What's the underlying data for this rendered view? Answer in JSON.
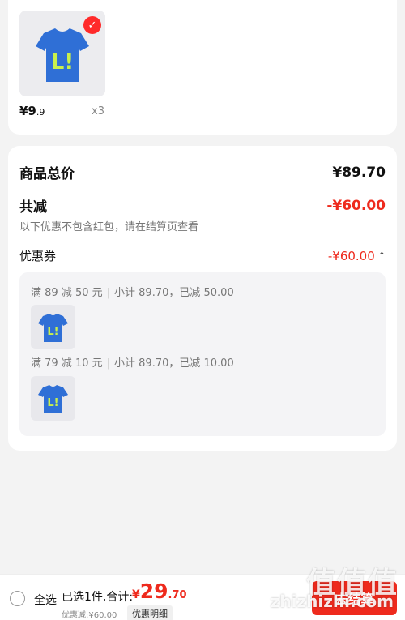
{
  "product": {
    "price_int": "¥9",
    "price_dec": ".9",
    "quantity": "x3",
    "image_icon": "blue-tshirt-icon",
    "shirt_print": "L!"
  },
  "summary": {
    "total_label": "商品总价",
    "total_value": "¥89.70",
    "reduce_label": "共减",
    "reduce_value": "-¥60.00",
    "reduce_note": "以下优惠不包含红包，请在结算页查看",
    "coupon_label": "优惠券",
    "coupon_value": "-¥60.00",
    "coupons": [
      {
        "rule": "满 89 减 50 元",
        "subtotal": "小计 89.70，已减 50.00"
      },
      {
        "rule": "满 79 减 10 元",
        "subtotal": "小计 89.70，已减 10.00"
      }
    ]
  },
  "bottom": {
    "select_all": "全选",
    "selected_text": "已选1件,合计:",
    "total_currency": "¥",
    "total_int": "29",
    "total_dec": ".70",
    "discount_note": "优惠减:¥60.00",
    "detail_button": "优惠明细",
    "checkout_button": "去结算"
  },
  "watermark": {
    "text": "值值值",
    "sub": "zhizhizhi.com"
  },
  "colors": {
    "accent": "#ee2a1d",
    "shirt_blue": "#2f6fd6",
    "print_green": "#c8f04c"
  }
}
